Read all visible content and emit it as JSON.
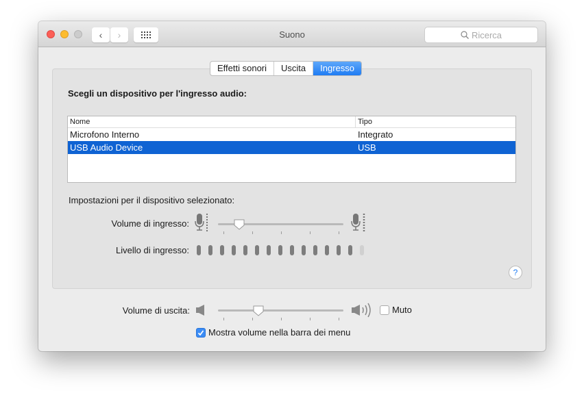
{
  "window": {
    "title": "Suono",
    "search_placeholder": "Ricerca"
  },
  "tabs": [
    {
      "label": "Effetti sonori"
    },
    {
      "label": "Uscita"
    },
    {
      "label": "Ingresso",
      "active": true
    }
  ],
  "input": {
    "heading": "Scegli un dispositivo per l'ingresso audio:",
    "columns": [
      "Nome",
      "Tipo"
    ],
    "devices": [
      {
        "name": "Microfono Interno",
        "type": "Integrato"
      },
      {
        "name": "USB Audio Device",
        "type": "USB",
        "selected": true
      }
    ],
    "settings_label": "Impostazioni per il dispositivo selezionato:",
    "volume_label": "Volume di ingresso:",
    "volume_percent": 17,
    "level_label": "Livello di ingresso:",
    "level_segments_total": 15,
    "level_segments_active": 14
  },
  "output": {
    "volume_label": "Volume di uscita:",
    "volume_percent": 32,
    "mute_label": "Muto",
    "mute_checked": false
  },
  "show_volume": {
    "label": "Mostra volume nella barra dei menu",
    "checked": true
  },
  "colors": {
    "accent": "#1f7cf3",
    "selection": "#0f63d3"
  }
}
